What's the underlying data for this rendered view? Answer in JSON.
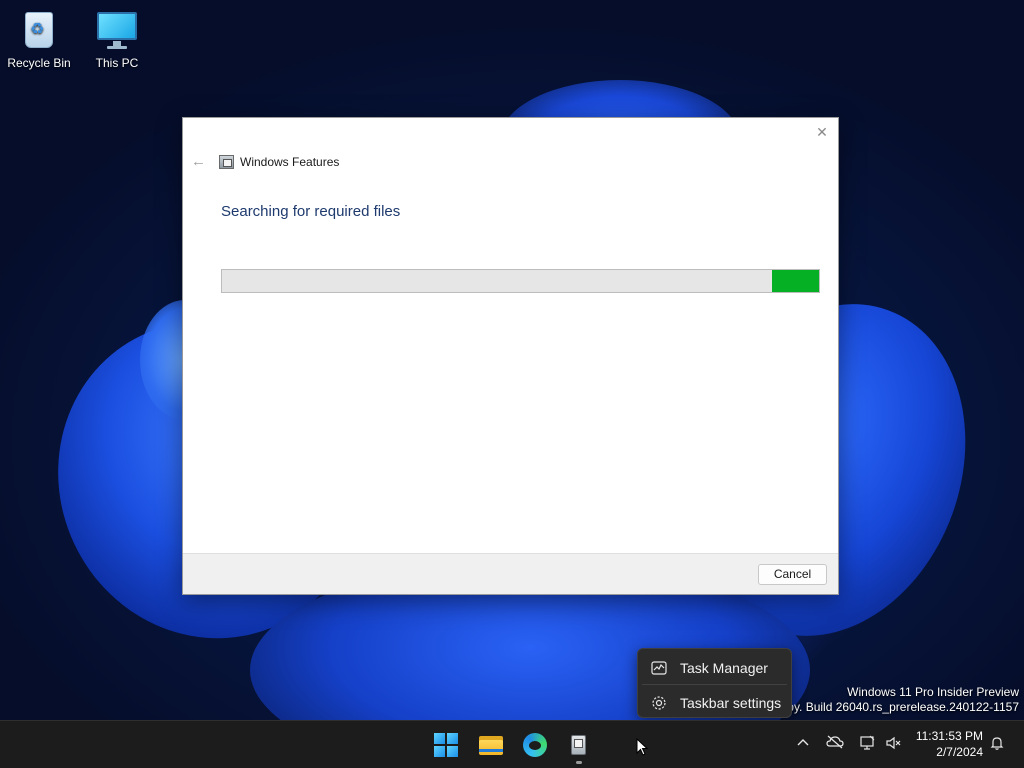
{
  "desktop": {
    "icons": [
      {
        "label": "Recycle Bin",
        "icon": "recycle-bin-icon"
      },
      {
        "label": "This PC",
        "icon": "monitor-icon"
      }
    ],
    "watermark": {
      "line1": "Windows 11 Pro Insider Preview",
      "line2": "Evaluation copy. Build 26040.rs_prerelease.240122-1157"
    }
  },
  "dialog": {
    "title": "Windows Features",
    "heading": "Searching for required files",
    "progress": 0.92,
    "progress_color": "#06b025",
    "cancel_label": "Cancel",
    "close_glyph": "✕",
    "back_glyph": "←"
  },
  "context_menu": {
    "items": [
      {
        "label": "Task Manager",
        "icon": "task-manager-icon"
      },
      {
        "label": "Taskbar settings",
        "icon": "gear-icon"
      }
    ]
  },
  "taskbar": {
    "apps": [
      {
        "name": "Start",
        "icon": "windows-start-icon"
      },
      {
        "name": "File Explorer",
        "icon": "folder-icon"
      },
      {
        "name": "Microsoft Edge",
        "icon": "edge-icon"
      },
      {
        "name": "Windows Features",
        "icon": "windows-features-icon"
      }
    ],
    "tray": {
      "time": "11:31:53 PM",
      "date": "2/7/2024"
    }
  }
}
